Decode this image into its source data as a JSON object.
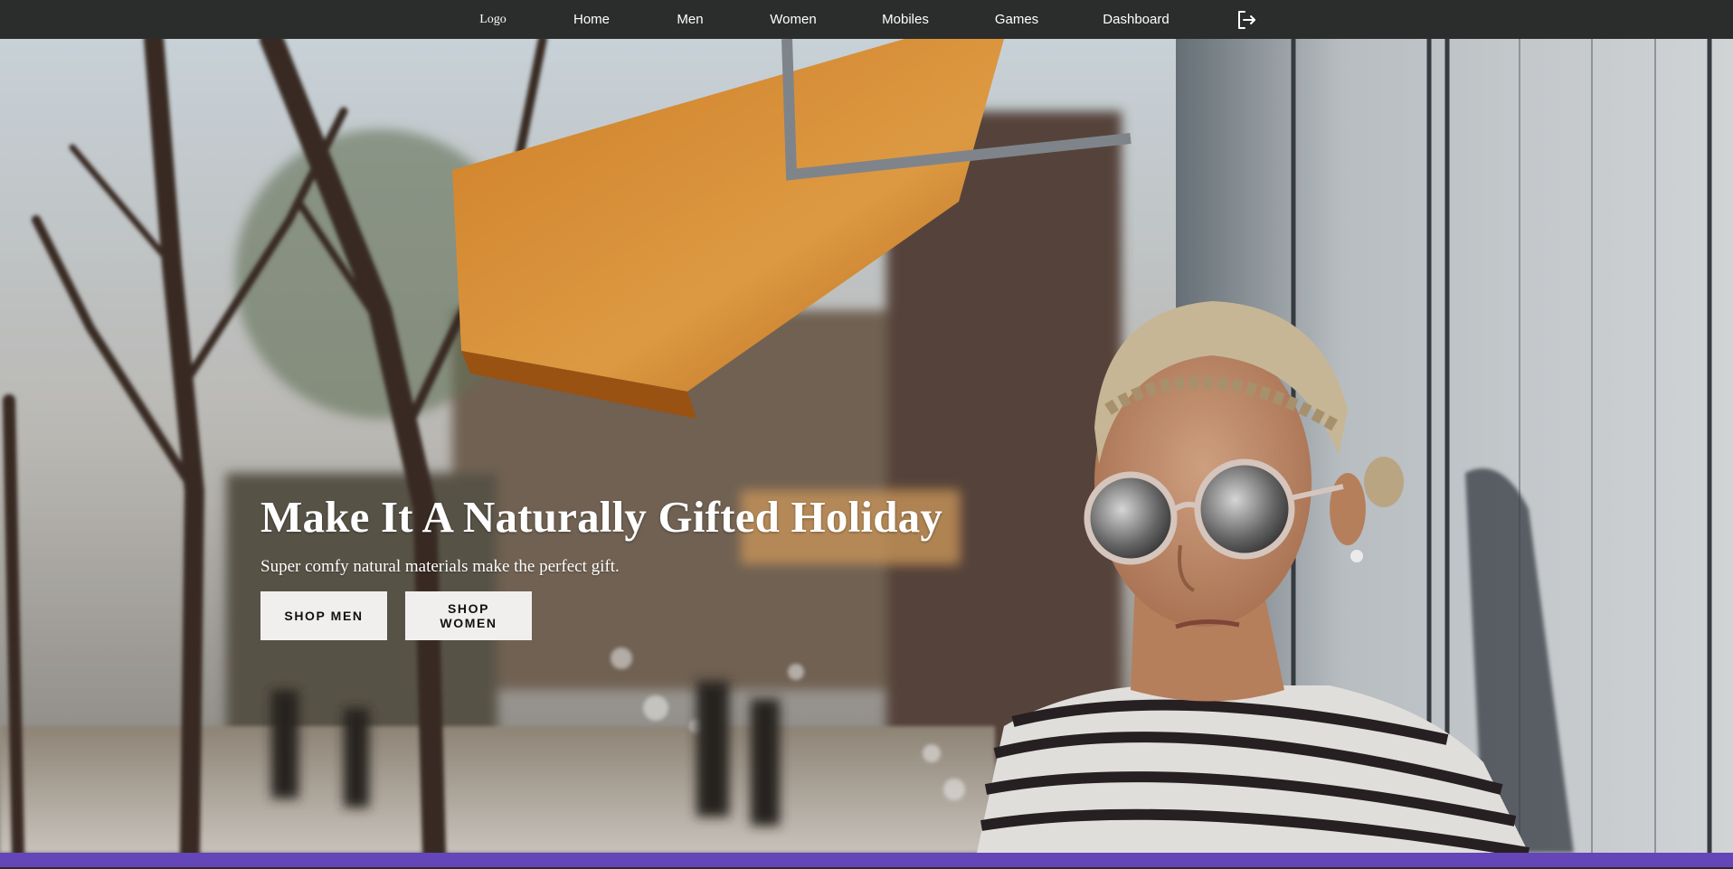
{
  "nav": {
    "logo": "Logo",
    "items": [
      {
        "label": "Home"
      },
      {
        "label": "Men"
      },
      {
        "label": "Women"
      },
      {
        "label": "Mobiles"
      },
      {
        "label": "Games"
      },
      {
        "label": "Dashboard"
      }
    ],
    "logout_icon": "logout-icon"
  },
  "hero": {
    "title": "Make It A Naturally Gifted Holiday",
    "subtitle": "Super comfy natural materials make the perfect gift.",
    "buttons": {
      "shop_men": "SHOP MEN",
      "shop_women": "SHOP WOMEN"
    },
    "image": "Woman with braided blonde hair and mirrored sunglasses in a striped shirt leaning against a wall on a sunny street with orange awnings"
  },
  "colors": {
    "navbar_bg": "#2b2d2c",
    "nav_text": "#ffffff",
    "button_bg": "#f1efee",
    "button_text": "#111111",
    "accent_strip": "#6446b8"
  }
}
